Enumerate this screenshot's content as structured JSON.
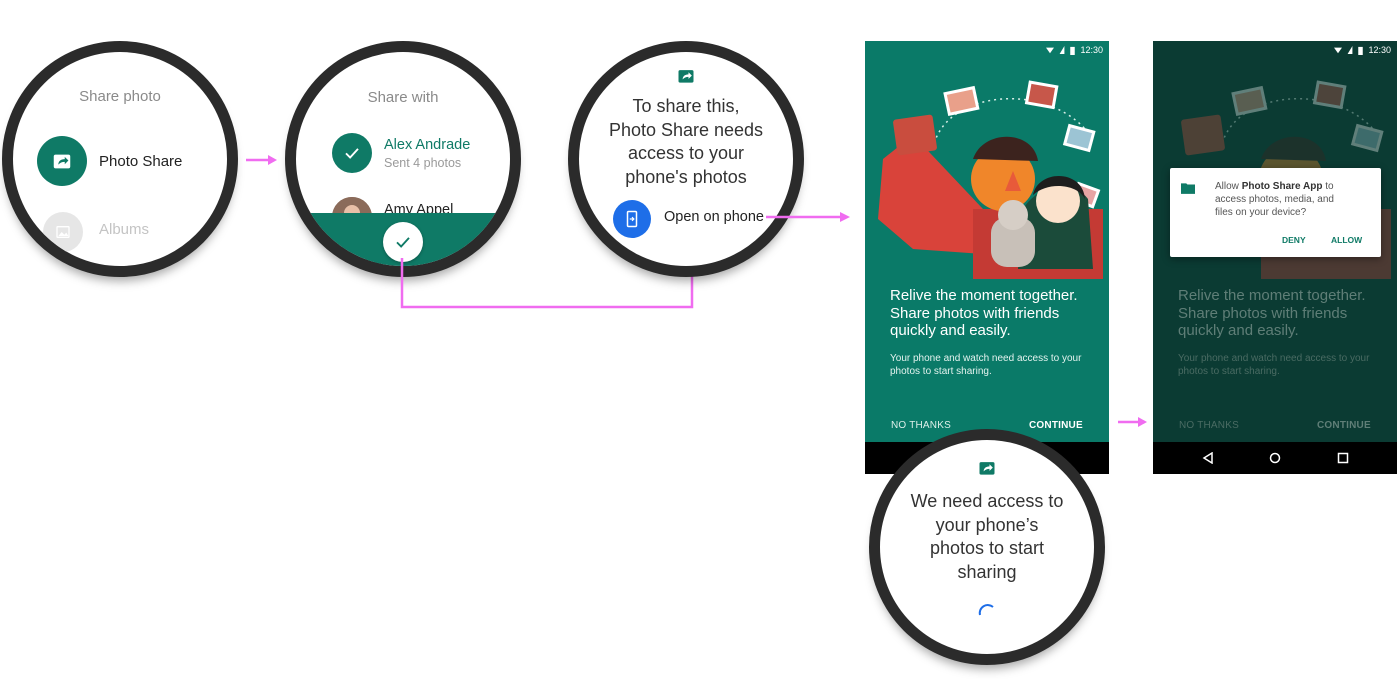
{
  "watch1": {
    "title": "Share photo",
    "items": [
      {
        "label": "Photo Share",
        "icon": "share-arrow-icon"
      },
      {
        "label": "Albums",
        "icon": "image-icon"
      }
    ]
  },
  "watch2": {
    "title": "Share with",
    "contact1": {
      "name": "Alex Andrade",
      "sub": "Sent 4 photos"
    },
    "contact2": {
      "name": "Amy Appel"
    },
    "confirm_icon": "check-icon"
  },
  "watch3": {
    "lines": [
      "To share this,",
      "Photo Share needs",
      "access to your",
      "phone's photos"
    ],
    "open_label": "Open on phone"
  },
  "phone1": {
    "status_time": "12:30",
    "headline": [
      "Relive the moment together.",
      "Share photos with friends",
      "quickly and easily."
    ],
    "body": [
      "Your phone and watch need access to your",
      "photos to start sharing."
    ],
    "no_thanks": "NO THANKS",
    "continue": "CONTINUE"
  },
  "phone2": {
    "status_time": "12:30",
    "headline": [
      "Relive the moment together.",
      "Share photos with friends",
      "quickly and easily."
    ],
    "body": [
      "Your phone and watch need access to your",
      "photos to start sharing."
    ],
    "no_thanks": "NO THANKS",
    "continue": "CONTINUE",
    "dialog": {
      "line1_pre": "Allow ",
      "line1_bold": "Photo Share App",
      "line1_post": " to",
      "line2": "access photos, media, and",
      "line3": "files on your device?",
      "deny": "DENY",
      "allow": "ALLOW"
    }
  },
  "watch4": {
    "lines": [
      "We need access to",
      "your phone’s",
      "photos to start",
      "sharing"
    ]
  },
  "colors": {
    "teal": "#0f7a66",
    "teal_dark": "#0a3a32",
    "arrow": "#f06cf0",
    "blue": "#1e6ee8"
  }
}
